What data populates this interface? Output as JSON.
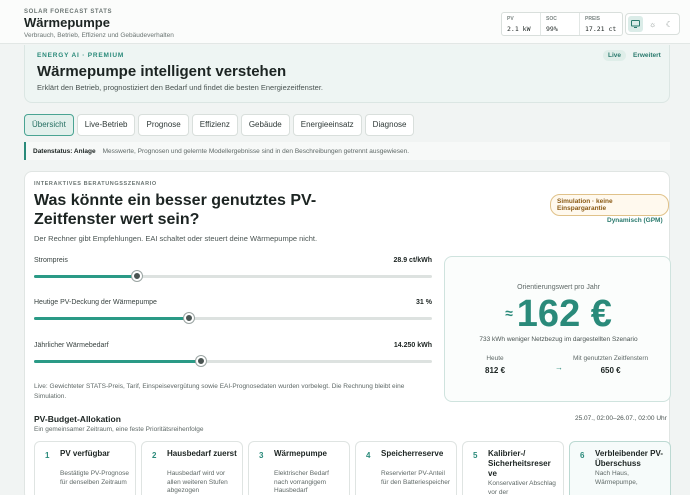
{
  "header": {
    "kicker": "SOLAR FORECAST STATS",
    "title": "Wärmepumpe",
    "subtitle": "Verbrauch, Betrieb, Effizienz und Gebäudeverhalten",
    "stats": [
      {
        "label": "PV",
        "value": "2.1 kW"
      },
      {
        "label": "SOC",
        "value": "99%"
      },
      {
        "label": "PREIS",
        "value": "17.21 ct"
      }
    ],
    "theme_icons": [
      "monitor-icon",
      "sun-icon",
      "moon-icon"
    ]
  },
  "hero": {
    "kicker": "ENERGY AI · PREMIUM",
    "title": "Wärmepumpe intelligent verstehen",
    "description": "Erklärt den Betrieb, prognostiziert den Bedarf und findet die besten Energiezeitfenster.",
    "live_badge": "Live",
    "advanced_link": "Erweitert"
  },
  "tabs": [
    "Übersicht",
    "Live-Betrieb",
    "Prognose",
    "Effizienz",
    "Gebäude",
    "Energieeinsatz",
    "Diagnose"
  ],
  "active_tab": "Übersicht",
  "status": {
    "label": "Datenstatus: Anlage",
    "text": "Messwerte, Prognosen und gelernte Modellergebnisse sind in den Beschreibungen getrennt ausgewiesen."
  },
  "scenario": {
    "kicker": "INTERAKTIVES BERATUNGSSZENARIO",
    "title": "Was könnte ein besser genutztes PV-Zeitfenster wert sein?",
    "description": "Der Rechner gibt Empfehlungen. EAI schaltet oder steuert deine Wärmepumpe nicht.",
    "sim_badge": "Simulation · keine Einspargarantie",
    "pricing_link": "Dynamisch (GPM)",
    "sliders": [
      {
        "label": "Strompreis",
        "value_text": "28.9 ct/kWh",
        "fraction": 0.26
      },
      {
        "label": "Heutige PV-Deckung der Wärmepumpe",
        "value_text": "31 %",
        "fraction": 0.39
      },
      {
        "label": "Jährlicher Wärmebedarf",
        "value_text": "14.250 kWh",
        "fraction": 0.42
      }
    ],
    "live_note": "Live: Gewichteter STATS-Preis, Tarif, Einspeisevergütung sowie EAI-Prognosedaten wurden vorbelegt. Die Rechnung bleibt eine Simulation.",
    "result": {
      "label": "Orientierungswert pro Jahr",
      "approx": "≈",
      "value": "162 €",
      "sub": "733 kWh weniger Netzbezug im dargestellten Szenario",
      "today_label": "Heute",
      "today_value": "812 €",
      "arrow": "→",
      "optimized_label": "Mit genutzten Zeitfenstern",
      "optimized_value": "650 €"
    }
  },
  "allocation": {
    "title": "PV-Budget-Allokation",
    "subtitle": "Ein gemeinsamer Zeitraum, eine feste Prioritätsreihenfolge",
    "range": "25.07., 02:00–26.07., 02:00 Uhr",
    "steps": [
      {
        "num": "1",
        "title": "PV verfügbar",
        "desc": "Bestätigte PV-Prognose für denselben Zeitraum"
      },
      {
        "num": "2",
        "title": "Hausbedarf zuerst",
        "desc": "Hausbedarf wird vor allen weiteren Stufen abgezogen"
      },
      {
        "num": "3",
        "title": "Wärmepumpe",
        "desc": "Elektrischer Bedarf nach vorrangigem Hausbedarf"
      },
      {
        "num": "4",
        "title": "Speicherreserve",
        "desc": "Reservierter PV-Anteil für den Batteriespeicher"
      },
      {
        "num": "5",
        "title": "Kalibrier-/ Sicherheitsreser ve",
        "desc": "Konservativer Abschlag vor der"
      },
      {
        "num": "6",
        "title": "Verbleibender PV-Überschuss",
        "desc": "Nach Haus, Wärmepumpe,"
      }
    ]
  }
}
